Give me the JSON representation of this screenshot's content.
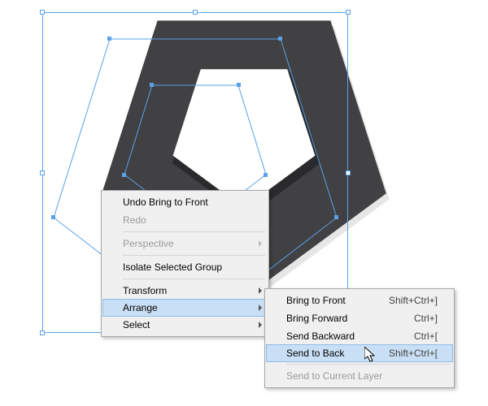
{
  "shape": {
    "fill": "#414042",
    "inner_fill": "#ffffff"
  },
  "menu": {
    "items": [
      {
        "label": "Undo Bring to Front",
        "enabled": true,
        "submenu": false
      },
      {
        "label": "Redo",
        "enabled": false,
        "submenu": false
      },
      {
        "sep": true
      },
      {
        "label": "Perspective",
        "enabled": false,
        "submenu": true
      },
      {
        "sep": true
      },
      {
        "label": "Isolate Selected Group",
        "enabled": true,
        "submenu": false
      },
      {
        "sep": true
      },
      {
        "label": "Transform",
        "enabled": true,
        "submenu": true
      },
      {
        "label": "Arrange",
        "enabled": true,
        "submenu": true,
        "active": true
      },
      {
        "label": "Select",
        "enabled": true,
        "submenu": true
      }
    ]
  },
  "submenu": {
    "title": "Arrange",
    "items": [
      {
        "label": "Bring to Front",
        "shortcut": "Shift+Ctrl+]",
        "enabled": true
      },
      {
        "label": "Bring Forward",
        "shortcut": "Ctrl+]",
        "enabled": true
      },
      {
        "label": "Send Backward",
        "shortcut": "Ctrl+[",
        "enabled": true
      },
      {
        "label": "Send to Back",
        "shortcut": "Shift+Ctrl+[",
        "enabled": true,
        "active": true
      },
      {
        "sep": true
      },
      {
        "label": "Send to Current Layer",
        "shortcut": "",
        "enabled": false
      }
    ]
  }
}
